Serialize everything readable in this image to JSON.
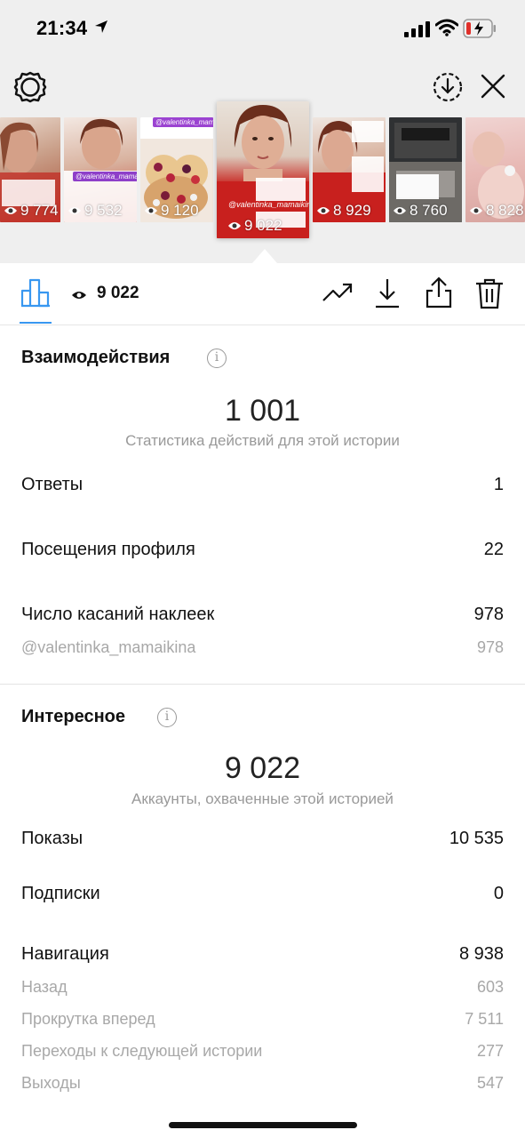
{
  "status_bar": {
    "time": "21:34"
  },
  "stories": [
    {
      "views": "9 774"
    },
    {
      "views": "9 532",
      "tag": "@valentinka_mamaikina"
    },
    {
      "views": "9 120",
      "tag": "@valentinka_mamaikina"
    },
    {
      "views": "9 022",
      "tag": "@valentinka_mamaikina",
      "active": true
    },
    {
      "views": "8 929"
    },
    {
      "views": "8 760"
    },
    {
      "views": "8 828"
    }
  ],
  "toolbar": {
    "view_count": "9 022"
  },
  "interactions": {
    "title": "Взаимодействия",
    "total": "1 001",
    "total_caption": "Статистика действий для этой истории",
    "rows": [
      {
        "label": "Ответы",
        "value": "1"
      },
      {
        "label": "Посещения профиля",
        "value": "22"
      },
      {
        "label": "Число касаний наклеек",
        "value": "978"
      }
    ],
    "sticker_detail": {
      "label": "@valentinka_mamaikina",
      "value": "978"
    }
  },
  "discovery": {
    "title": "Интересное",
    "total": "9 022",
    "total_caption": "Аккаунты, охваченные этой историей",
    "rows": [
      {
        "label": "Показы",
        "value": "10 535"
      },
      {
        "label": "Подписки",
        "value": "0"
      },
      {
        "label": "Навигация",
        "value": "8 938"
      }
    ],
    "navigation_details": [
      {
        "label": "Назад",
        "value": "603"
      },
      {
        "label": "Прокрутка вперед",
        "value": "7 511"
      },
      {
        "label": "Переходы к следующей истории",
        "value": "277"
      },
      {
        "label": "Выходы",
        "value": "547"
      }
    ]
  },
  "colors": {
    "accent": "#3897f0",
    "muted": "#a8a8a8",
    "story_red": "#c8201e"
  }
}
